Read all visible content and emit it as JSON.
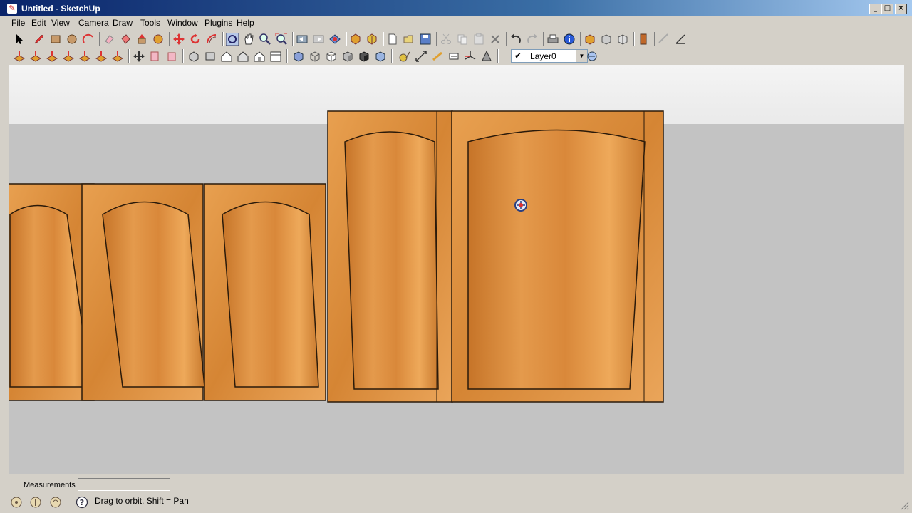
{
  "window": {
    "title": "Untitled - SketchUp",
    "app_icon": "sketchup-icon",
    "controls": [
      "minimize",
      "maximize",
      "close"
    ]
  },
  "menu": [
    "File",
    "Edit",
    "View",
    "Camera",
    "Draw",
    "Tools",
    "Window",
    "Plugins",
    "Help"
  ],
  "toolbar1": {
    "tools": [
      "select",
      "pencil",
      "rectangle",
      "circle",
      "arc",
      "eraser",
      "paint-bucket",
      "push-pull",
      "move",
      "follow-me",
      "rotate",
      "offset",
      "orbit",
      "pan",
      "zoom",
      "zoom-extents",
      "previous-view",
      "next-view",
      "get-models",
      "share-model",
      "new",
      "open",
      "save",
      "cut",
      "copy",
      "paste",
      "delete",
      "undo",
      "redo",
      "print",
      "model-info",
      "components",
      "materials",
      "styles",
      "scenes",
      "layers-manager",
      "tape-measure",
      "protractor"
    ]
  },
  "toolbar2": {
    "tools": [
      "sandbox-from-contours",
      "sandbox-from-scratch",
      "smoove",
      "stamp",
      "drape",
      "add-detail",
      "flip-edge",
      "section-plane",
      "display-section-planes",
      "display-section-cuts",
      "iso-view",
      "top-view",
      "front-view",
      "right-view",
      "back-view",
      "left-view",
      "xray",
      "wireframe",
      "hidden-line",
      "shaded",
      "shaded-textures",
      "monochrome",
      "tape-measure",
      "dimensions",
      "protractor",
      "text",
      "axes",
      "3d-text"
    ],
    "layer": {
      "checked": true,
      "name": "Layer0"
    }
  },
  "viewport": {
    "cursor": "orbit-cursor-icon",
    "model": "cabinet-doors"
  },
  "status": {
    "measurements_label": "Measurements",
    "measurements_value": "",
    "message": "Drag to orbit.  Shift = Pan"
  },
  "colors": {
    "wood": "#d98a3a",
    "wood_dark": "#b5651d",
    "sky": "#f2f2f2",
    "ground": "#c3c3c3",
    "red_axis": "#dd3333"
  }
}
